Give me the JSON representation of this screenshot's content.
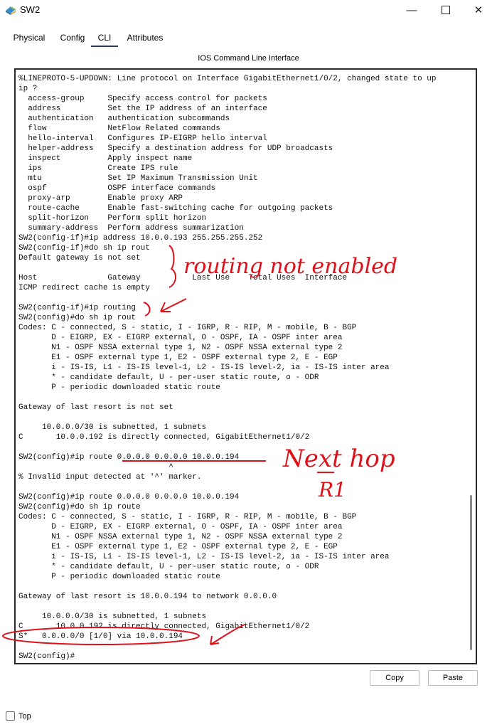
{
  "window": {
    "title": "SW2",
    "icon": "packet-tracer-switch-icon",
    "minimize_glyph": "—",
    "close_glyph": "✕"
  },
  "tabs": [
    {
      "label": "Physical"
    },
    {
      "label": "Config"
    },
    {
      "label": "CLI",
      "active": true
    },
    {
      "label": "Attributes"
    }
  ],
  "panel_title": "IOS Command Line Interface",
  "terminal_lines": [
    "%LINEPROTO-5-UPDOWN: Line protocol on Interface GigabitEthernet1/0/2, changed state to up",
    "ip ?",
    "  access-group     Specify access control for packets",
    "  address          Set the IP address of an interface",
    "  authentication   authentication subcommands",
    "  flow             NetFlow Related commands",
    "  hello-interval   Configures IP-EIGRP hello interval",
    "  helper-address   Specify a destination address for UDP broadcasts",
    "  inspect          Apply inspect name",
    "  ips              Create IPS rule",
    "  mtu              Set IP Maximum Transmission Unit",
    "  ospf             OSPF interface commands",
    "  proxy-arp        Enable proxy ARP",
    "  route-cache      Enable fast-switching cache for outgoing packets",
    "  split-horizon    Perform split horizon",
    "  summary-address  Perform address summarization",
    "SW2(config-if)#ip address 10.0.0.193 255.255.255.252",
    "SW2(config-if)#do sh ip rout",
    "Default gateway is not set",
    "",
    "Host               Gateway           Last Use    Total Uses  Interface",
    "ICMP redirect cache is empty",
    "",
    "SW2(config-if)#ip routing",
    "SW2(config)#do sh ip rout",
    "Codes: C - connected, S - static, I - IGRP, R - RIP, M - mobile, B - BGP",
    "       D - EIGRP, EX - EIGRP external, O - OSPF, IA - OSPF inter area",
    "       N1 - OSPF NSSA external type 1, N2 - OSPF NSSA external type 2",
    "       E1 - OSPF external type 1, E2 - OSPF external type 2, E - EGP",
    "       i - IS-IS, L1 - IS-IS level-1, L2 - IS-IS level-2, ia - IS-IS inter area",
    "       * - candidate default, U - per-user static route, o - ODR",
    "       P - periodic downloaded static route",
    "",
    "Gateway of last resort is not set",
    "",
    "     10.0.0.0/30 is subnetted, 1 subnets",
    "C       10.0.0.192 is directly connected, GigabitEthernet1/0/2",
    "",
    "SW2(config)#ip route 0.0.0.0 0.0.0.0 10.0.0.194",
    "                                ^",
    "% Invalid input detected at '^' marker.",
    "",
    "SW2(config)#ip route 0.0.0.0 0.0.0.0 10.0.0.194",
    "SW2(config)#do sh ip route",
    "Codes: C - connected, S - static, I - IGRP, R - RIP, M - mobile, B - BGP",
    "       D - EIGRP, EX - EIGRP external, O - OSPF, IA - OSPF inter area",
    "       N1 - OSPF NSSA external type 1, N2 - OSPF NSSA external type 2",
    "       E1 - OSPF external type 1, E2 - OSPF external type 2, E - EGP",
    "       i - IS-IS, L1 - IS-IS level-1, L2 - IS-IS level-2, ia - IS-IS inter area",
    "       * - candidate default, U - per-user static route, o - ODR",
    "       P - periodic downloaded static route",
    "",
    "Gateway of last resort is 10.0.0.194 to network 0.0.0.0",
    "",
    "     10.0.0.0/30 is subnetted, 1 subnets",
    "C       10.0.0.192 is directly connected, GigabitEthernet1/0/2",
    "S*   0.0.0.0/0 [1/0] via 10.0.0.194",
    "",
    "SW2(config)#"
  ],
  "annotations": {
    "color": "#e0101a",
    "routing_note": "routing not enabled",
    "next_hop_note": "Next hop",
    "next_hop_sub": "R1"
  },
  "buttons": {
    "copy_label": "Copy",
    "paste_label": "Paste"
  },
  "top_checkbox": {
    "label": "Top",
    "checked": false
  }
}
